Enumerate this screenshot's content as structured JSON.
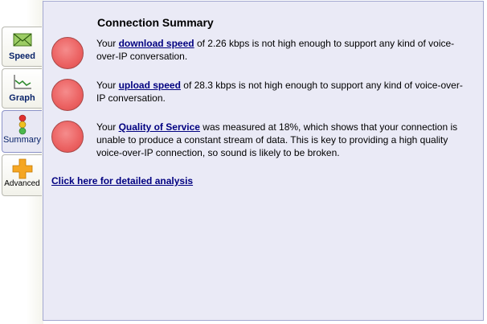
{
  "tabs": [
    {
      "label": "Speed",
      "icon": "envelope-speed-icon"
    },
    {
      "label": "Graph",
      "icon": "line-graph-icon"
    },
    {
      "label": "Summary",
      "icon": "traffic-light-icon",
      "active": true
    },
    {
      "label": "Advanced",
      "icon": "plus-icon"
    }
  ],
  "panel": {
    "title": "Connection Summary",
    "rows": [
      {
        "prefix": "Your ",
        "link": "download speed",
        "suffix": " of 2.26 kbps is not high enough to support any kind of voice-over-IP conversation.",
        "status_color": "#ec6464"
      },
      {
        "prefix": "Your ",
        "link": "upload speed",
        "suffix": " of 28.3 kbps is not high enough to support any kind of voice-over-IP conversation.",
        "status_color": "#ec6464"
      },
      {
        "prefix": "Your ",
        "link": "Quality of Service",
        "suffix": " was measured at 18%, which shows that your connection is unable to produce a constant stream of data. This is key to providing a high quality voice-over-IP connection, so sound is likely to be broken.",
        "status_color": "#ec6464"
      }
    ],
    "detail_link": "Click here for detailed analysis"
  }
}
